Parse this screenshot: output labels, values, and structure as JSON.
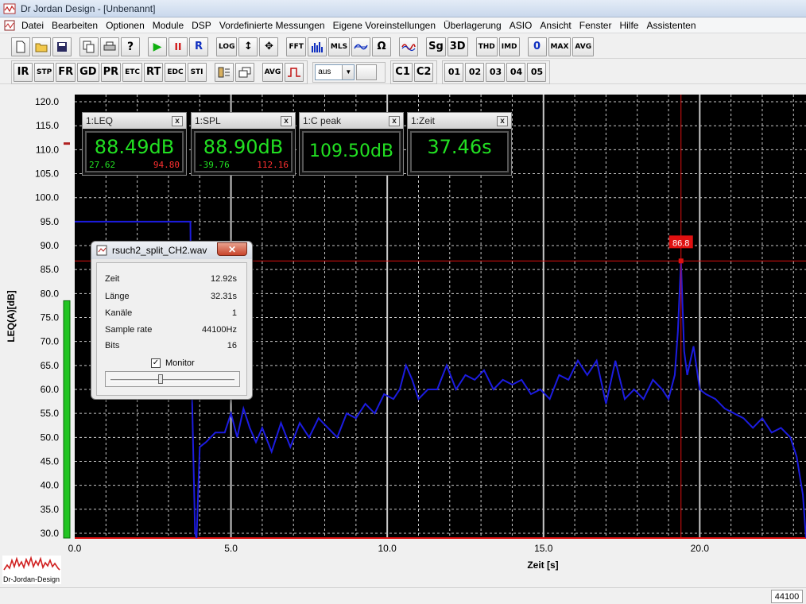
{
  "window": {
    "title": "Dr Jordan Design - [Unbenannt]"
  },
  "menu": [
    "Datei",
    "Bearbeiten",
    "Optionen",
    "Module",
    "DSP",
    "Vordefinierte Messungen",
    "Eigene Voreinstellungen",
    "Überlagerung",
    "ASIO",
    "Ansicht",
    "Fenster",
    "Hilfe",
    "Assistenten"
  ],
  "toolbar1": {
    "run": "▶",
    "pause": "II",
    "r": "R",
    "log": "LOG",
    "fft": "FFT",
    "mls": "MLS",
    "omega": "Ω",
    "sg": "Sg",
    "3d": "3D",
    "thd": "THD",
    "imd": "IMD",
    "zero": "0",
    "max": "MAX",
    "avg": "AVG"
  },
  "toolbar2": {
    "ir": "IR",
    "stp": "STP",
    "fr": "FR",
    "gd": "GD",
    "pr": "PR",
    "etc": "ETC",
    "rt": "RT",
    "edc": "EDC",
    "sti": "STI",
    "avg": "AVG",
    "select": "aus",
    "c1": "C1",
    "c2": "C2",
    "presets": [
      "01",
      "02",
      "03",
      "04",
      "05"
    ]
  },
  "meters": [
    {
      "title": "1:LEQ",
      "value": "88.49dB",
      "min": "27.62",
      "max": "94.80"
    },
    {
      "title": "1:SPL",
      "value": "88.90dB",
      "min": "-39.76",
      "max": "112.16"
    },
    {
      "title": "1:C peak",
      "value": "109.50dB",
      "min": "",
      "max": ""
    },
    {
      "title": "1:Zeit",
      "value": "37.46s",
      "min": "",
      "max": ""
    }
  ],
  "dialog": {
    "title": "rsuch2_split_CH2.wav",
    "rows": [
      {
        "label": "Zeit",
        "value": "12.92s"
      },
      {
        "label": "Länge",
        "value": "32.31s"
      },
      {
        "label": "Kanäle",
        "value": "1"
      },
      {
        "label": "Sample rate",
        "value": "44100Hz"
      },
      {
        "label": "Bits",
        "value": "16"
      }
    ],
    "monitor_label": "Monitor",
    "monitor_checked": true,
    "slider_fraction": 0.4
  },
  "logo": "Dr-Jordan-Design",
  "status": {
    "rate": "44100"
  },
  "chart_data": {
    "type": "line",
    "xlabel": "Zeit [s]",
    "ylabel": "LEQ(A)[dB]",
    "xlim": [
      0,
      23.4
    ],
    "ylim": [
      29,
      121.5
    ],
    "xticks": [
      "0.0",
      "5.0",
      "10.0",
      "15.0",
      "20.0"
    ],
    "yticks": [
      "30.0",
      "35.0",
      "40.0",
      "45.0",
      "50.0",
      "55.0",
      "60.0",
      "65.0",
      "70.0",
      "75.0",
      "80.0",
      "85.0",
      "90.0",
      "95.0",
      "100.0",
      "105.0",
      "110.0",
      "115.0",
      "120.0"
    ],
    "cursor": {
      "x": 19.4,
      "y": 86.8,
      "label": "86.8"
    },
    "level_bar_value": 78.5,
    "colors": {
      "series": "#1c1ce0",
      "cursor": "#e01010",
      "grid": "#c8c8c8",
      "level": "#22c422"
    },
    "series": [
      {
        "x": [
          0,
          3.7,
          3.75,
          3.85,
          3.9,
          4.0,
          4.2,
          4.5,
          4.8,
          5.0,
          5.2,
          5.4,
          5.6,
          5.8,
          6.0,
          6.3,
          6.6,
          6.9,
          7.2,
          7.5,
          7.8,
          8.1,
          8.4,
          8.7,
          9.0,
          9.3,
          9.6,
          9.9,
          10.2,
          10.4,
          10.6,
          10.8,
          11.0,
          11.3,
          11.6,
          11.9,
          12.2,
          12.5,
          12.8,
          13.1,
          13.4,
          13.7,
          14.0,
          14.3,
          14.6,
          14.9,
          15.2,
          15.5,
          15.8,
          16.1,
          16.4,
          16.7,
          17.0,
          17.3,
          17.6,
          17.9,
          18.2,
          18.5,
          18.8,
          19.0,
          19.2,
          19.3,
          19.4,
          19.5,
          19.6,
          19.8,
          20.0,
          20.2,
          20.5,
          20.8,
          21.1,
          21.4,
          21.7,
          22.0,
          22.3,
          22.6,
          22.9,
          23.1,
          23.3,
          23.4
        ],
        "y": [
          95,
          95,
          60,
          30,
          29,
          48,
          49,
          51,
          51,
          55,
          50,
          56,
          52,
          49,
          52,
          47,
          53,
          48,
          53,
          50,
          54,
          52,
          50,
          55,
          54,
          57,
          55,
          59,
          58,
          60,
          65,
          62,
          58,
          60,
          60,
          65,
          60,
          63,
          62,
          64,
          60,
          62,
          61,
          62,
          59,
          60,
          58,
          63,
          62,
          66,
          63,
          66,
          57,
          66,
          58,
          60,
          58,
          62,
          60,
          58,
          63,
          72,
          86.8,
          68,
          63,
          69,
          60,
          59,
          58,
          56,
          55,
          54,
          52,
          54,
          51,
          52,
          50,
          46,
          38,
          29
        ]
      }
    ]
  }
}
